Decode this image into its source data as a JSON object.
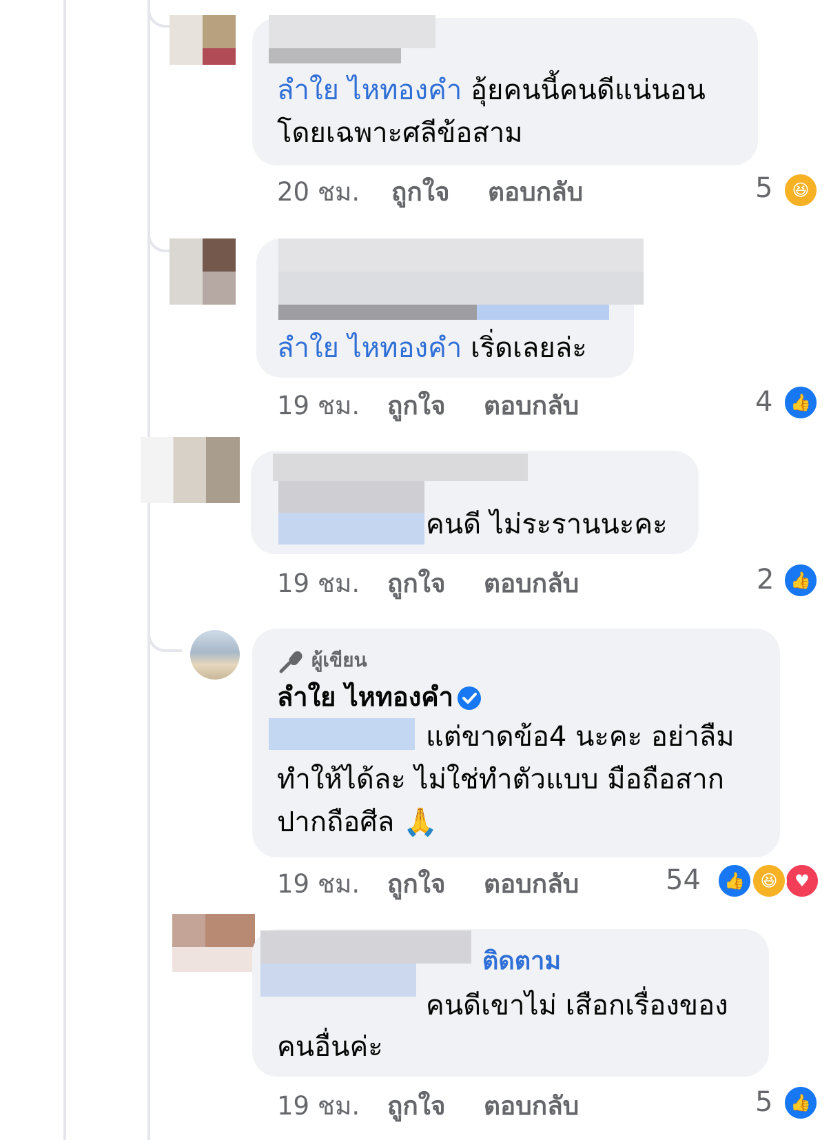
{
  "comments": [
    {
      "mention": "ลำใย ไหทองคำ",
      "line1_rest": " อุ้ยคนนี้คนดีแน่นอน",
      "line2": "โดยเฉพาะศลีข้อสาม",
      "time": "20 ชม.",
      "like_label": "ถูกใจ",
      "reply_label": "ตอบกลับ",
      "reaction_count": "5",
      "reactions": [
        "haha"
      ]
    },
    {
      "mention": "ลำใย ไหทองคำ",
      "line1_rest": " เริ่ดเลยล่ะ",
      "time": "19 ชม.",
      "like_label": "ถูกใจ",
      "reply_label": "ตอบกลับ",
      "reaction_count": "4",
      "reactions": [
        "like"
      ]
    },
    {
      "line1_rest": "คนดี ไม่ระรานนะคะ",
      "time": "19 ชม.",
      "like_label": "ถูกใจ",
      "reply_label": "ตอบกลับ",
      "reaction_count": "2",
      "reactions": [
        "like"
      ]
    },
    {
      "badge": "ผู้เขียน",
      "author": "ลำใย ไหทองคำ",
      "line1_rest": "แต่ขาดข้อ4 นะคะ อย่าลืม",
      "line2": "ทำให้ได้ละ ไม่ใช่ทำตัวแบบ มือถือสาก",
      "line3": "ปากถือศีล",
      "emoji": "🙏",
      "time": "19 ชม.",
      "like_label": "ถูกใจ",
      "reply_label": "ตอบกลับ",
      "reaction_count": "54",
      "reactions": [
        "like",
        "haha",
        "love"
      ]
    },
    {
      "follow_label": "ติดตาม",
      "line1_rest": "คนดีเขาไม่ เสือกเรื่องของ",
      "line2": "คนอื่นค่ะ",
      "time": "19 ชม.",
      "like_label": "ถูกใจ",
      "reply_label": "ตอบกลับ",
      "reaction_count": "5",
      "reactions": [
        "like"
      ]
    }
  ],
  "colors": {
    "bubble": "#f0f2f5",
    "mention": "#2f6fd6",
    "meta": "#65676b",
    "like": "#1877f2",
    "haha": "#f7b125",
    "love": "#f33e58"
  }
}
